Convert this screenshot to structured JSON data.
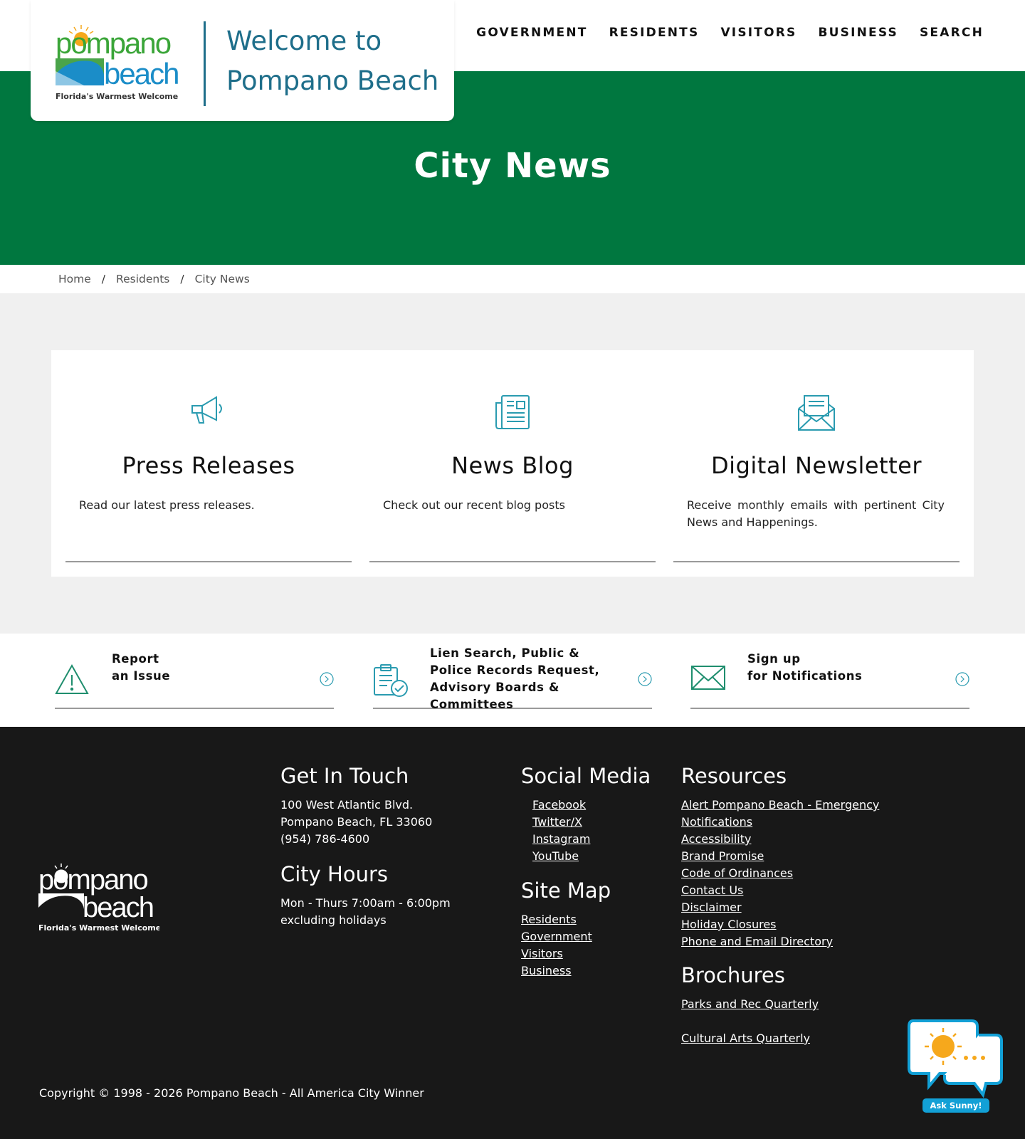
{
  "header": {
    "logo": {
      "word1": "pompano",
      "word2": "beach",
      "tagline": "Florida's Warmest Welcome"
    },
    "welcome": "Welcome to Pompano Beach",
    "nav": [
      "GOVERNMENT",
      "RESIDENTS",
      "VISITORS",
      "BUSINESS",
      "SEARCH"
    ]
  },
  "hero": {
    "title": "City News"
  },
  "breadcrumb": {
    "items": [
      "Home",
      "Residents",
      "City News"
    ],
    "separator": "/"
  },
  "cards": [
    {
      "icon": "megaphone-icon",
      "title": "Press Releases",
      "text": "Read our latest press releases."
    },
    {
      "icon": "newspaper-icon",
      "title": "News Blog",
      "text": "Check out our recent blog posts"
    },
    {
      "icon": "envelope-letter-icon",
      "title": "Digital Newsletter",
      "text": "Receive monthly emails with pertinent City News and Happenings."
    }
  ],
  "quick_links": [
    {
      "icon": "warning-icon",
      "line1": "Report",
      "line2": "an Issue"
    },
    {
      "icon": "clipboard-check-icon",
      "label": "Lien Search, Public & Police Records Request, Advisory Boards & Committees"
    },
    {
      "icon": "mail-icon",
      "line1": "Sign up",
      "line2": "for Notifications"
    }
  ],
  "footer": {
    "logo": {
      "word1": "pompano",
      "word2": "beach",
      "tagline": "Florida's Warmest Welcome"
    },
    "get_in_touch": {
      "heading": "Get In Touch",
      "address1": "100 West Atlantic Blvd.",
      "address2": "Pompano Beach, FL 33060",
      "phone": "(954) 786-4600"
    },
    "city_hours": {
      "heading": "City Hours",
      "line1": "Mon - Thurs 7:00am - 6:00pm",
      "line2": "excluding holidays"
    },
    "social": {
      "heading": "Social Media",
      "links": [
        "Facebook",
        "Twitter/X",
        "Instagram",
        "YouTube"
      ]
    },
    "site_map": {
      "heading": "Site Map",
      "links": [
        "Residents",
        "Government",
        "Visitors",
        "Business"
      ]
    },
    "resources": {
      "heading": "Resources",
      "links": [
        "Alert Pompano Beach - Emergency Notifications",
        "Accessibility",
        "Brand Promise",
        "Code of Ordinances",
        "Contact Us",
        "Disclaimer",
        "Holiday Closures",
        "Phone and Email Directory"
      ]
    },
    "brochures": {
      "heading": "Brochures",
      "links": [
        "Parks and Rec Quarterly",
        "Cultural Arts Quarterly"
      ]
    },
    "copyright": "Copyright © 1998 - 2026 Pompano Beach - All America City Winner"
  },
  "chat": {
    "label": "Ask Sunny!",
    "icon": "sun-chat-icon"
  },
  "colors": {
    "brand_green": "#00773f",
    "teal": "#1e6e8a",
    "icon_teal": "#2a9bb0",
    "footer_bg": "#181818",
    "chat_blue": "#12a0d6"
  }
}
